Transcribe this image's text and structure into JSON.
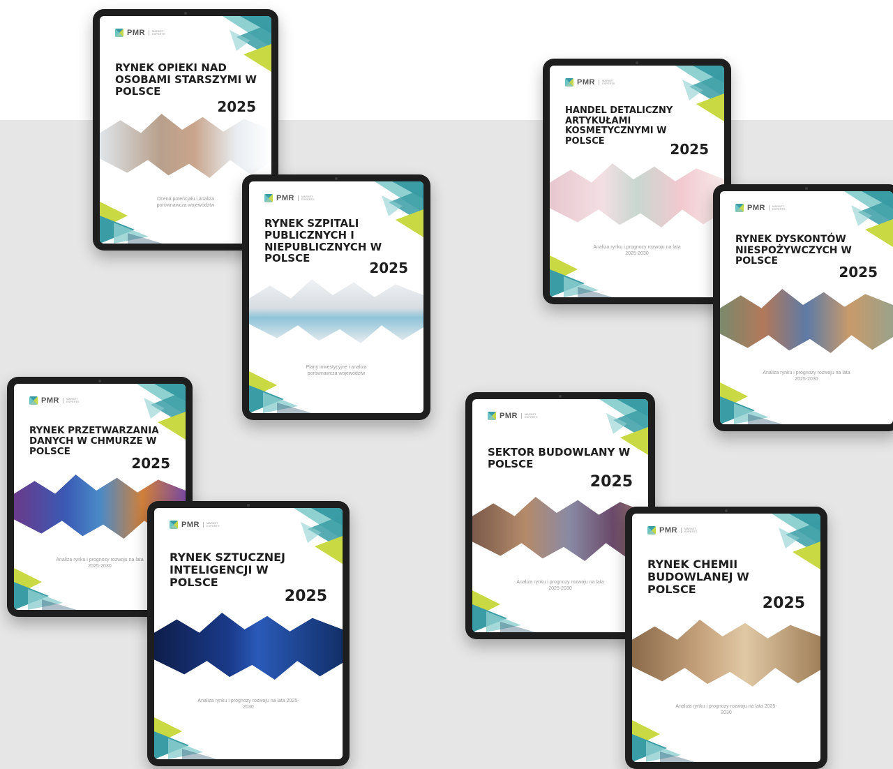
{
  "brand": {
    "logo_text": "PMR",
    "logo_tagline": "MARKET EXPERTS"
  },
  "colors": {
    "teal": "#3a9ca4",
    "light_teal": "#8fd0d0",
    "lime": "#c8d944",
    "navy": "#1e4a6a"
  },
  "reports": [
    {
      "title": "RYNEK OPIEKI NAD OSOBAMI STARSZYMI W POLSCE",
      "year": "2025",
      "subtitle": "Ocena potencjału i analiza porównawcza województw",
      "image": "elderly-care-hands"
    },
    {
      "title": "RYNEK SZPITALI PUBLICZNYCH I NIEPUBLICZNYCH W POLSCE",
      "year": "2025",
      "subtitle": "Plany inwestycyjne i analiza porównawcza województw",
      "image": "hospital-beds"
    },
    {
      "title": "HANDEL DETALICZNY ARTYKUŁAMI KOSMETYCZNYMI W POLSCE",
      "year": "2025",
      "subtitle": "Analiza rynku i prognozy rozwoju na lata 2025-2030",
      "image": "cosmetics"
    },
    {
      "title": "RYNEK DYSKONTÓW NIESPOŻYWCZYCH W POLSCE",
      "year": "2025",
      "subtitle": "Analiza rynku i prognozy rozwoju na lata 2025-2030",
      "image": "discount-store"
    },
    {
      "title": "RYNEK PRZETWARZANIA DANYCH W CHMURZE W POLSCE",
      "year": "2025",
      "subtitle": "Analiza rynku i prognozy rozwoju na lata 2025-2030",
      "image": "cloud-data"
    },
    {
      "title": "RYNEK SZTUCZNEJ INTELIGENCJI W POLSCE",
      "year": "2025",
      "subtitle": "Analiza rynku i prognozy rozwoju na lata 2025-2030",
      "image": "ai-chip"
    },
    {
      "title": "SEKTOR BUDOWLANY W POLSCE",
      "year": "2025",
      "subtitle": "Analiza rynku i prognozy rozwoju na lata 2025-2030",
      "image": "construction-site"
    },
    {
      "title": "RYNEK CHEMII BUDOWLANEJ W POLSCE",
      "year": "2025",
      "subtitle": "Analiza rynku i prognozy rozwoju na lata 2025-2030",
      "image": "building-chemicals"
    }
  ]
}
